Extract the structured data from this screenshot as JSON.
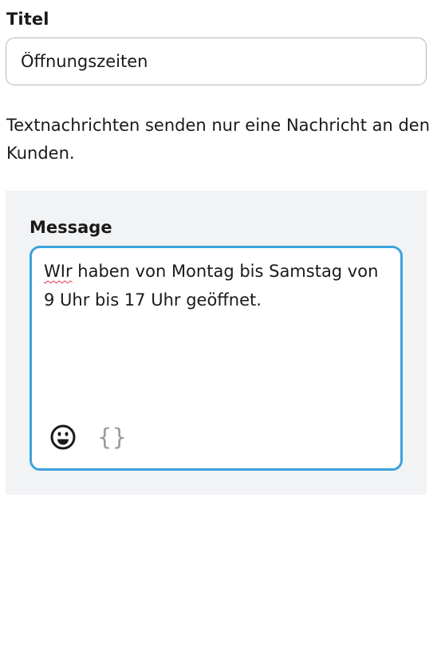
{
  "form": {
    "title_label": "Titel",
    "title_value": "Öffnungszeiten",
    "info_text": "Textnachrichten senden nur eine Nachricht an den Kunden."
  },
  "message": {
    "label": "Message",
    "text_misspelled": "WIr",
    "text_rest": " haben von Montag bis Samstag von 9 Uhr bis 17 Uhr geöffnet.",
    "toolbar": {
      "emoji_icon": "emoji-smile-icon",
      "variables_glyph": "{}",
      "variables_icon": "curly-braces-icon"
    }
  },
  "colors": {
    "focus_border": "#3ba3dd",
    "panel_background": "#f2f3f5",
    "spellcheck_underline": "#e0364f"
  }
}
